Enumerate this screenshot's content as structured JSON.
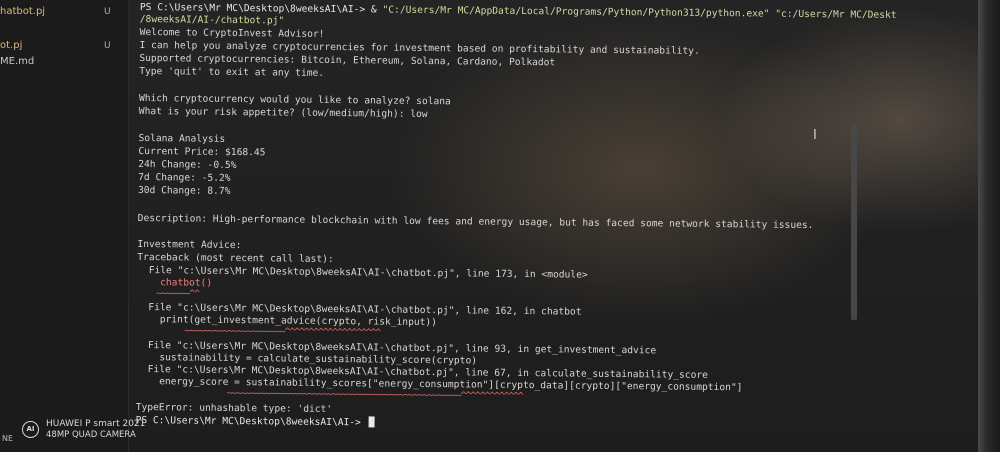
{
  "sidebar": {
    "items": [
      {
        "label": "hatbot.pj",
        "badge": "U"
      },
      {
        "label": "ot.pj",
        "badge": "U"
      },
      {
        "label": "ME.md",
        "badge": ""
      }
    ],
    "bottom_label": "NE"
  },
  "terminal": {
    "lines": [
      {
        "prompt": "PS C:\\Users\\Mr MC\\Desktop\\8weeksAI\\AI-> ",
        "amp": "& ",
        "cmd": "\"C:/Users/Mr MC/AppData/Local/Programs/Python/Python313/python.exe\" \"c:/Users/Mr MC/Deskt"
      },
      {
        "text": "/8weeksAI/AI-/chatbot.pj\""
      },
      {
        "text": "Welcome to CryptoInvest Advisor!"
      },
      {
        "text": "I can help you analyze cryptocurrencies for investment based on profitability and sustainability."
      },
      {
        "text": "Supported cryptocurrencies: Bitcoin, Ethereum, Solana, Cardano, Polkadot"
      },
      {
        "text": "Type 'quit' to exit at any time."
      },
      {
        "text": "Which cryptocurrency would you like to analyze? solana"
      },
      {
        "text": "What is your risk appetite? (low/medium/high): low"
      },
      {
        "text": "Solana Analysis"
      },
      {
        "text": "Current Price: $168.45"
      },
      {
        "text": "24h Change: -0.5%"
      },
      {
        "text": "7d Change: -5.2%"
      },
      {
        "text": "30d Change: 8.7%"
      },
      {
        "text": "Description: High-performance blockchain with low fees and energy usage, but has faced some network stability issues."
      },
      {
        "text": "Investment Advice:"
      },
      {
        "text": "Traceback (most recent call last):"
      },
      {
        "text": "  File \"c:\\Users\\Mr MC\\Desktop\\8weeksAI\\AI-\\chatbot.pj\", line 173, in <module>"
      },
      {
        "text": "    chatbot()"
      },
      {
        "text": "    ~~~~~~~^^"
      },
      {
        "text": "  File \"c:\\Users\\Mr MC\\Desktop\\8weeksAI\\AI-\\chatbot.pj\", line 162, in chatbot"
      },
      {
        "text": "    print(get_investment_advice(crypto, risk_input))"
      },
      {
        "text": "          ~~~~~~~~~~~~~~~~~~~~~^^^^^^^^^^^^^^^^^^^^"
      },
      {
        "text": "  File \"c:\\Users\\Mr MC\\Desktop\\8weeksAI\\AI-\\chatbot.pj\", line 93, in get_investment_advice"
      },
      {
        "text": "    sustainability = calculate_sustainability_score(crypto)"
      },
      {
        "text": "  File \"c:\\Users\\Mr MC\\Desktop\\8weeksAI\\AI-\\chatbot.pj\", line 67, in calculate_sustainability_score"
      },
      {
        "text": "    energy_score = sustainability_scores[\"energy_consumption\"][crypto_data][crypto][\"energy_consumption\"]"
      },
      {
        "text": "                   ~~~~~~~~~~~~~~~~~~~~~~~~~~~~~~~~~~~~~~~~~~~~~~~~~^^^^^^^^^^^^^"
      },
      {
        "text": "TypeError: unhashable type: 'dict'"
      },
      {
        "text": "PS C:\\Users\\Mr MC\\Desktop\\8weeksAI\\AI-> "
      }
    ]
  },
  "watermark": {
    "line1": "HUAWEI P smart 2021",
    "line2": "48MP QUAD CAMERA",
    "logo": "AI"
  },
  "colors": {
    "background": "#1d1d1d",
    "text": "#d6d6d6",
    "error_squiggle": "#e06c6c",
    "string_path": "#d7d7a0"
  }
}
